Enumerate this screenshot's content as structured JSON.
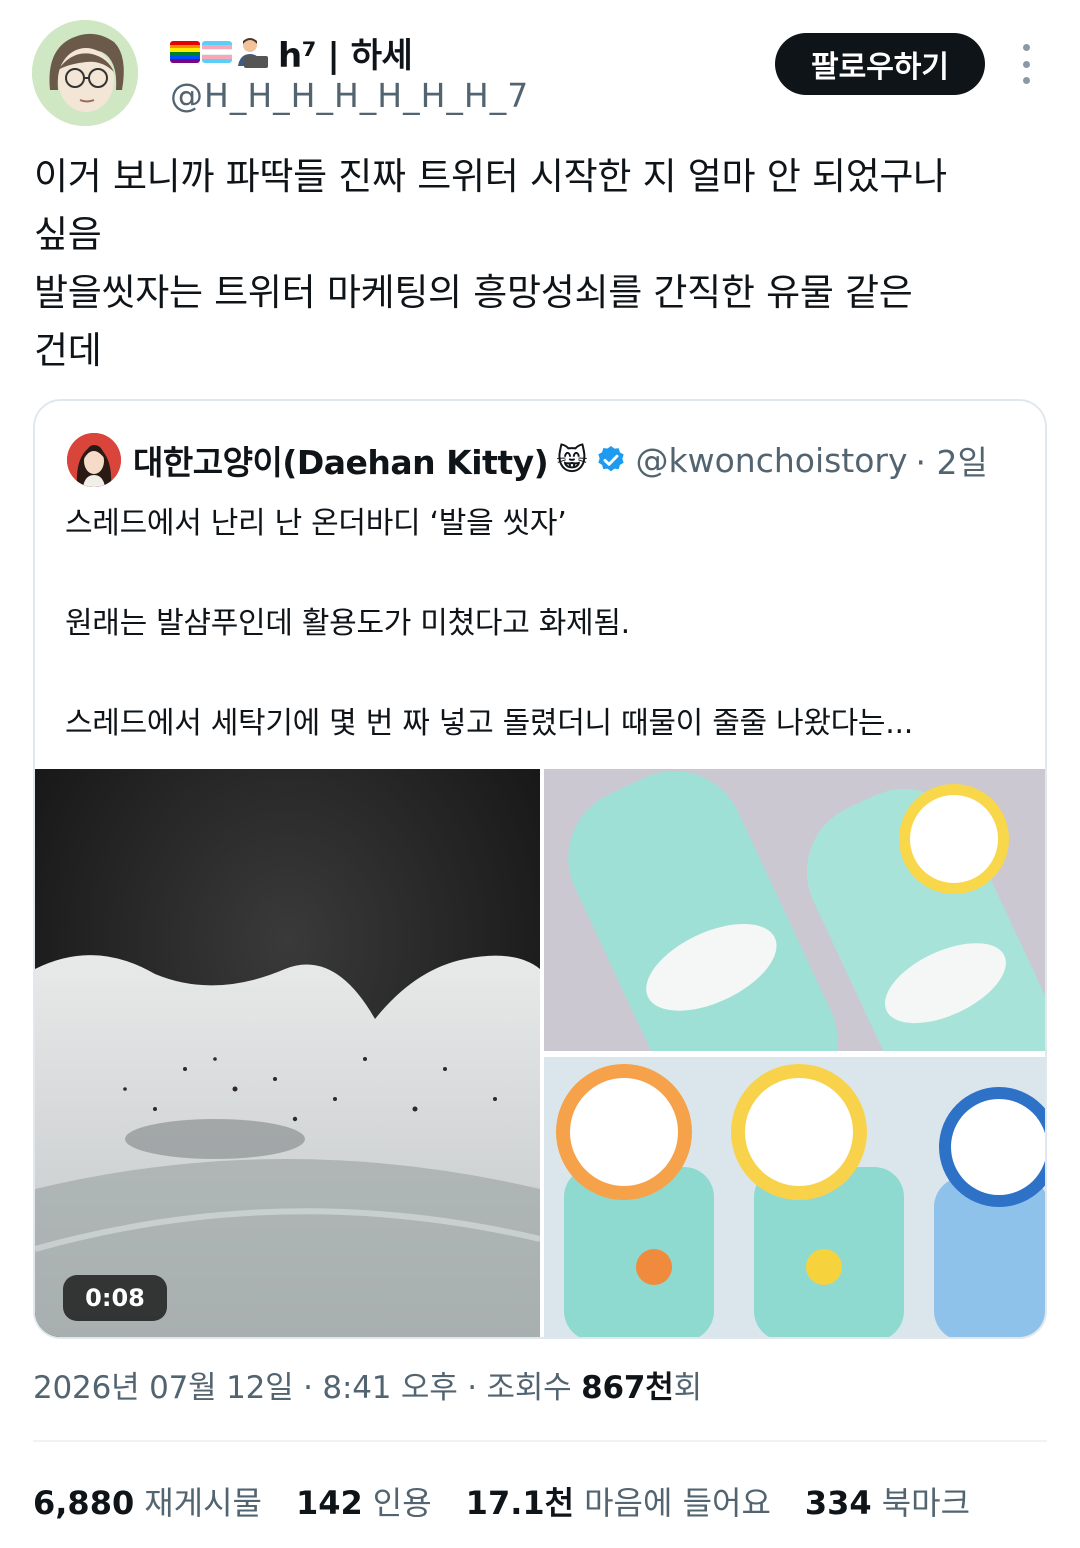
{
  "author": {
    "display_name": "h⁷ | 하세",
    "handle": "@H_H_H_H_H_H_H_7",
    "emoji": [
      "rainbow-flag",
      "transgender-flag",
      "technologist-emoji"
    ]
  },
  "follow_button": {
    "label": "팔로우하기"
  },
  "tweet": {
    "lines": [
      "이거 보니까 파딱들 진짜 트위터 시작한 지 얼마 안 되었구나",
      "싶음",
      "발을씻자는 트위터 마케팅의 흥망성쇠를 간직한 유물 같은",
      "건데"
    ]
  },
  "quote": {
    "display_name": "대한고양이(Daehan Kitty)",
    "name_emoji": "😸",
    "verified": true,
    "handle": "@kwonchoistory",
    "time": "· 2일",
    "lines": [
      "스레드에서 난리 난 온더바디 ‘발을 씻자’",
      "",
      "원래는 발샴푸인데 활용도가 미쳤다고 화제됨.",
      "",
      "스레드에서 세탁기에 몇 번 짜 넣고 돌렸더니 때물이 줄줄 나왔다는..."
    ],
    "video_duration": "0:08"
  },
  "meta": {
    "date": "2026년 07월 12일",
    "time": "8:41 오후",
    "views_prefix": "조회수",
    "views_value": "867천",
    "views_suffix": "회"
  },
  "stats": {
    "retweets_value": "6,880",
    "retweets_label": "재게시물",
    "quotes_value": "142",
    "quotes_label": "인용",
    "likes_value": "17.1천",
    "likes_label": "마음에 들어요",
    "bookmarks_value": "334",
    "bookmarks_label": "북마크"
  },
  "colors": {
    "text": "#0f1419",
    "secondary": "#536471",
    "verified": "#1d9bf0",
    "button": "#0f1419"
  }
}
